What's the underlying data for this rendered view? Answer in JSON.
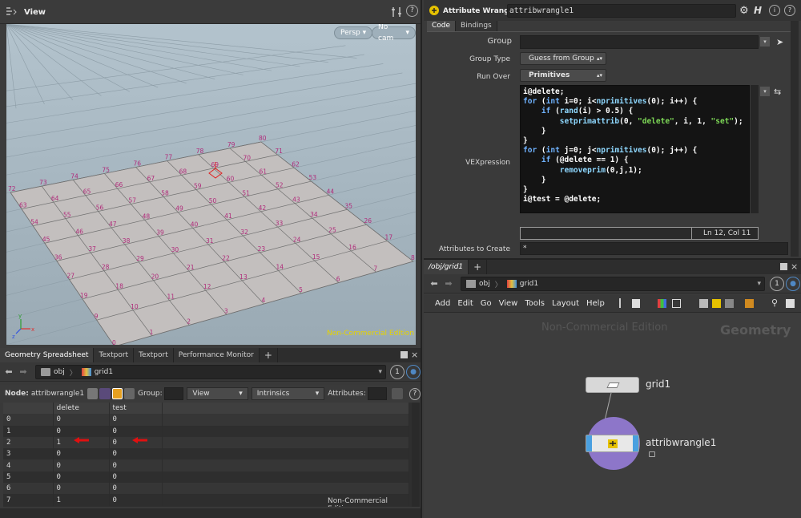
{
  "viewport": {
    "title": "View",
    "camera_menu": "Persp",
    "cam_menu": "No cam",
    "watermark": "Non-Commercial Edition",
    "axis_labels": {
      "x": "x",
      "y": "y",
      "z": "z"
    },
    "point_numbers": [
      "0",
      "1",
      "2",
      "3",
      "4",
      "5",
      "6",
      "7",
      "8",
      "9",
      "10",
      "11",
      "12",
      "13",
      "14",
      "15",
      "16",
      "17",
      "19",
      "18",
      "20",
      "21",
      "22",
      "23",
      "24",
      "25",
      "26",
      "27",
      "28",
      "29",
      "30",
      "31",
      "32",
      "33",
      "34",
      "35",
      "36",
      "37",
      "38",
      "39",
      "40",
      "41",
      "42",
      "43",
      "44",
      "45",
      "46",
      "47",
      "48",
      "49",
      "50",
      "51",
      "52",
      "53",
      "54",
      "55",
      "56",
      "57",
      "58",
      "59",
      "60",
      "61",
      "62",
      "63",
      "64",
      "65",
      "66",
      "67",
      "68",
      "69",
      "70",
      "71",
      "72",
      "73",
      "74",
      "75",
      "76",
      "77",
      "78",
      "79",
      "80"
    ]
  },
  "spreadsheet": {
    "tabs": [
      "Geometry Spreadsheet",
      "Textport",
      "Textport",
      "Performance Monitor",
      "+"
    ],
    "path": {
      "root": "obj",
      "node": "grid1"
    },
    "node_label": "Node:",
    "node_name": "attribwrangle1",
    "group_label": "Group:",
    "view_dropdown": "View",
    "intrinsics_dropdown": "Intrinsics",
    "attributes_label": "Attributes:",
    "columns": [
      "",
      "delete",
      "test"
    ],
    "rows": [
      [
        "0",
        "0",
        "0"
      ],
      [
        "1",
        "0",
        "0"
      ],
      [
        "2",
        "1",
        "0"
      ],
      [
        "3",
        "0",
        "0"
      ],
      [
        "4",
        "0",
        "0"
      ],
      [
        "5",
        "0",
        "0"
      ],
      [
        "6",
        "0",
        "0"
      ],
      [
        "7",
        "1",
        "0"
      ]
    ],
    "watermark": "Non-Commercial Edition",
    "annotation_color": "#e01010"
  },
  "params": {
    "node_type": "Attribute Wrangle",
    "node_name": "attribwrangle1",
    "tabs": [
      "Code",
      "Bindings"
    ],
    "group_label": "Group",
    "group_value": "",
    "group_type_label": "Group Type",
    "group_type_value": "Guess from Group",
    "run_over_label": "Run Over",
    "run_over_value": "Primitives",
    "vexpression_label": "VEXpression",
    "code_lines": [
      "i@delete;",
      "for (int i=0; i<nprimitives(0); i++) {",
      "    if (rand(i) > 0.5) {",
      "        setprimattrib(0, \"delete\", i, 1, \"set\");",
      "    }",
      "}",
      "for (int j=0; j<nprimitives(0); j++) {",
      "    if (@delete == 1) {",
      "        removeprim(0,j,1);",
      "    }",
      "}",
      "i@test = @delete;"
    ],
    "cursor_position": "Ln 12, Col 11",
    "attributes_to_create_label": "Attributes to Create",
    "attributes_to_create_value": "*"
  },
  "network": {
    "tabs": [
      "/obj/grid1",
      "+"
    ],
    "path": {
      "root": "obj",
      "node": "grid1"
    },
    "menu": [
      "Add",
      "Edit",
      "Go",
      "View",
      "Tools",
      "Layout",
      "Help"
    ],
    "watermark": "Non-Commercial Edition",
    "context_label": "Geometry",
    "nodes": [
      {
        "name": "grid1"
      },
      {
        "name": "attribwrangle1"
      }
    ]
  },
  "colors": {
    "accent_blue": "#4f88c4",
    "flag_yellow": "#e6c200",
    "node_purple": "#8d76c9"
  }
}
